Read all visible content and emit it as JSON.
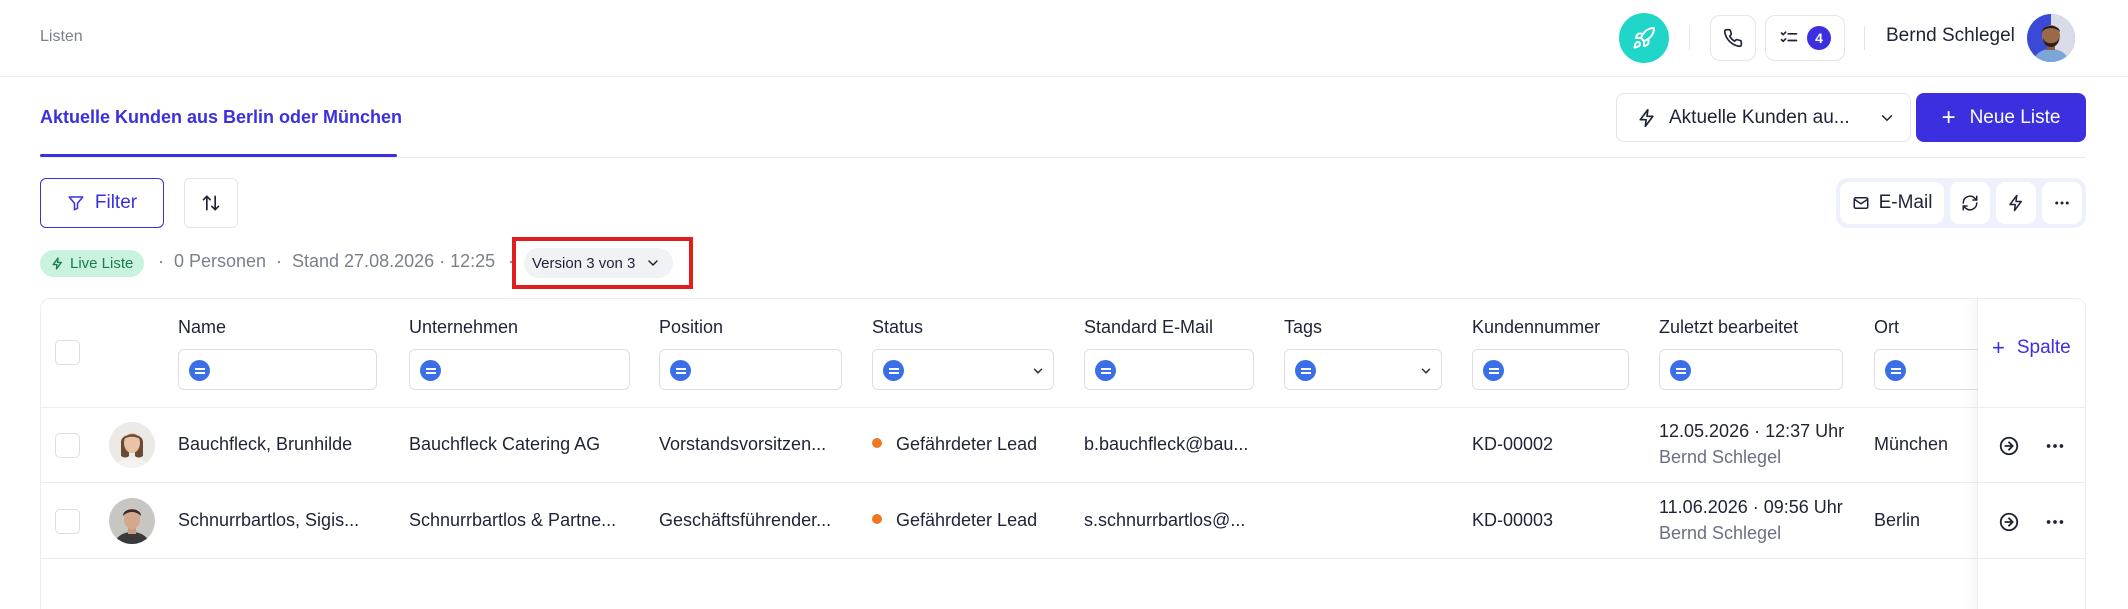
{
  "topbar": {
    "breadcrumb": "Listen",
    "tasks_count": "4",
    "user_name": "Bernd Schlegel"
  },
  "tabs": {
    "active_label": "Aktuelle Kunden aus Berlin oder München"
  },
  "toolbar": {
    "list_select_label": "Aktuelle Kunden au...",
    "new_list_label": "Neue Liste",
    "filter_label": "Filter",
    "email_label": "E-Mail"
  },
  "meta": {
    "live_label": "Live Liste",
    "persons": "0 Personen",
    "stand": "Stand 27.08.2026 · 12:25",
    "version": "Version 3 von 3",
    "sep": "·"
  },
  "table": {
    "columns": [
      "Name",
      "Unternehmen",
      "Position",
      "Status",
      "Standard E-Mail",
      "Tags",
      "Kundennummer",
      "Zuletzt bearbeitet",
      "Ort"
    ],
    "add_column_label": "Spalte",
    "rows": [
      {
        "name": "Bauchfleck, Brunhilde",
        "company": "Bauchfleck Catering AG",
        "position": "Vorstandsvorsitzen...",
        "status": "Gefährdeter Lead",
        "email": "b.bauchfleck@bau...",
        "tags": "",
        "customer_no": "KD-00002",
        "edited_date": "12.05.2026 · 12:37 Uhr",
        "edited_by": "Bernd Schlegel",
        "city": "München"
      },
      {
        "name": "Schnurrbartlos, Sigis...",
        "company": "Schnurrbartlos & Partne...",
        "position": "Geschäftsführender...",
        "status": "Gefährdeter Lead",
        "email": "s.schnurrbartlos@...",
        "tags": "",
        "customer_no": "KD-00003",
        "edited_date": "11.06.2026 · 09:56 Uhr",
        "edited_by": "Bernd Schlegel",
        "city": "Berlin"
      }
    ]
  },
  "colors": {
    "accent": "#3b2fe0",
    "rocket": "#1fd6c8",
    "status_orange": "#f07622",
    "live_green_bg": "#c9f3df",
    "highlight_red": "#e21d1d"
  }
}
